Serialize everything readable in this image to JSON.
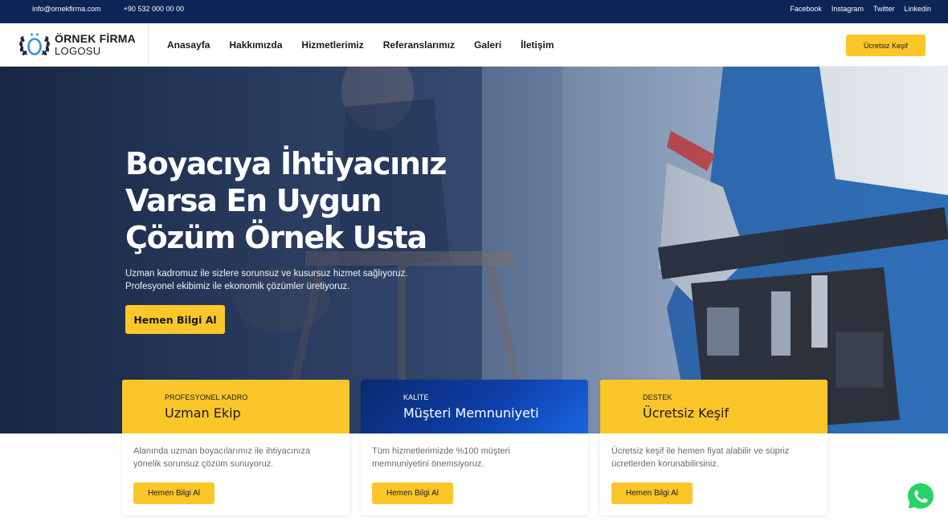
{
  "topbar": {
    "email": "info@ornekfirma.com",
    "phone": "+90 532 000 00 00",
    "social": [
      "Facebook",
      "Instagram",
      "Twitter",
      "Linkedin"
    ]
  },
  "logo": {
    "line1": "ÖRNEK FİRMA",
    "line2": "LOGOSU"
  },
  "nav": {
    "items": [
      "Anasayfa",
      "Hakkımızda",
      "Hizmetlerimiz",
      "Referanslarımız",
      "Galeri",
      "İletişim"
    ]
  },
  "header": {
    "cta_label": "Ücretsiz Keşif"
  },
  "hero": {
    "title_lines": [
      "Boyacıya İhtiyacınız",
      "Varsa En Uygun",
      "Çözüm Örnek Usta"
    ],
    "description_lines": [
      "Uzman kadromuz ile sizlere sorunsuz ve kusursuz hizmet sağlıyoruz.",
      "Profesyonel ekibimiz ile ekonomik çözümler üretiyoruz."
    ],
    "button_label": "Hemen Bilgi Al"
  },
  "cards": [
    {
      "label": "PROFESYONEL KADRO",
      "title": "Uzman Ekip",
      "body_lines": [
        "Alanında uzman boyacılarımız ile ihtiyacınıza",
        "yönelik sorunsuz çözüm sunuyoruz."
      ],
      "button_label": "Hemen Bilgi Al",
      "style": "yellow"
    },
    {
      "label": "KALİTE",
      "title": "Müşteri Memnuniyeti",
      "body_lines": [
        "Tüm hizmetlerimizde %100 müşteri",
        "memnuniyetini önemsiyoruz."
      ],
      "button_label": "Hemen Bilgi Al",
      "style": "blue"
    },
    {
      "label": "DESTEK",
      "title": "Ücretsiz Keşif",
      "body_lines": [
        "Ücretsiz keşif ile hemen fiyat alabilir ve süpriz",
        "ücretlerden korunabilirsiniz."
      ],
      "button_label": "Hemen Bilgi Al",
      "style": "yellow"
    }
  ],
  "colors": {
    "topbar": "#0c2456",
    "accent": "#fbc62a",
    "card_blue": "#0d3fa8",
    "whatsapp": "#25d366"
  },
  "icons": {
    "logo": "laurel-wreath-o-icon",
    "whatsapp": "whatsapp-icon"
  }
}
